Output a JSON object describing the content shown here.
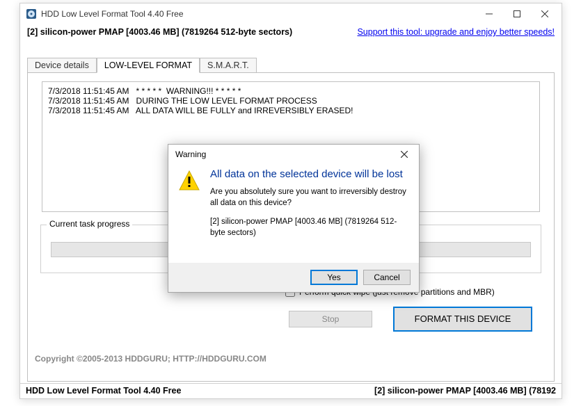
{
  "title": "HDD Low Level Format Tool 4.40   Free",
  "device_line": "[2]  silicon-power   PMAP   [4003.46 MB]   (7819264 512-byte sectors)",
  "support_link": "Support this tool: upgrade and enjoy better speeds!",
  "tabs": {
    "details": "Device details",
    "format": "LOW-LEVEL FORMAT",
    "smart": "S.M.A.R.T."
  },
  "log": [
    "7/3/2018 11:51:45 AM   * * * * *  WARNING!!! * * * * *",
    "7/3/2018 11:51:45 AM   DURING THE LOW LEVEL FORMAT PROCESS",
    "7/3/2018 11:51:45 AM   ALL DATA WILL BE FULLY and IRREVERSIBLY ERASED!"
  ],
  "progress_label": "Current task progress",
  "quick_wipe_label": "Perform quick wipe (just remove partitions and MBR)",
  "stop_label": "Stop",
  "format_label": "FORMAT THIS DEVICE",
  "copyright": "Copyright ©2005-2013 HDDGURU;   HTTP://HDDGURU.COM",
  "status_left": "HDD Low Level Format Tool 4.40   Free",
  "status_right": "[2]  silicon-power   PMAP   [4003.46 MB]   (78192",
  "dialog": {
    "title": "Warning",
    "headline": "All data on the selected device will be lost",
    "message": "Are you absolutely sure you want to irreversibly destroy all data on this device?",
    "device": "[2]  silicon-power   PMAP   [4003.46 MB]   (7819264 512-byte sectors)",
    "yes": "Yes",
    "cancel": "Cancel"
  }
}
